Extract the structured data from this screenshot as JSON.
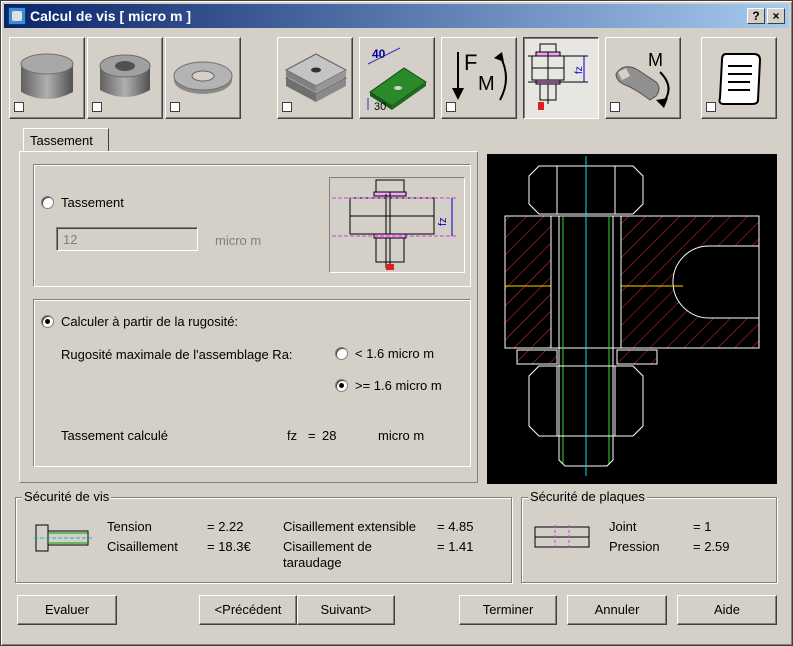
{
  "window": {
    "title": "Calcul de vis [ micro m ]",
    "help_button": "?",
    "close_button": "×"
  },
  "toolbar": {
    "buttons": [
      {
        "name": "bolt-head",
        "icon": "bolt-head-icon"
      },
      {
        "name": "nut",
        "icon": "nut-icon"
      },
      {
        "name": "washer",
        "icon": "washer-icon"
      },
      {
        "name": "plates",
        "icon": "plates-icon"
      },
      {
        "name": "plate-dimensions",
        "icon": "plate-dimension-icon",
        "label_top": "40",
        "label_bottom": "30"
      },
      {
        "name": "force-moment",
        "icon": "force-moment-icon",
        "label_f": "F",
        "label_m": "M"
      },
      {
        "name": "settlement",
        "icon": "settlement-icon",
        "label": "fz",
        "pressed": true
      },
      {
        "name": "tightening-torque",
        "icon": "wrench-torque-icon",
        "label": "M"
      },
      {
        "name": "report",
        "icon": "report-icon"
      }
    ]
  },
  "tabs": [
    {
      "label": "Tassement"
    }
  ],
  "settlement": {
    "radio_manual_label": "Tassement",
    "manual_value": "12",
    "manual_unit": "micro m",
    "diagram_label": "fz",
    "radio_rough_label": "Calculer à partir de la rugosité:",
    "roughness_label": "Rugosité maximale de l'assemblage Ra:",
    "option_low": "< 1.6  micro m",
    "option_high": ">= 1.6  micro m",
    "computed_label": "Tassement calculé",
    "computed_symbol": "fz",
    "computed_eq": "=",
    "computed_value": "28",
    "computed_unit": "micro m"
  },
  "bolt_safety": {
    "title": "Sécurité de vis",
    "tension_label": "Tension",
    "tension_value": "= 2.22",
    "shear_label": "Cisaillement",
    "shear_value": "= 18.3€",
    "ext_shear_label": "Cisaillement extensible",
    "ext_shear_value": "= 4.85",
    "thread_shear_label_1": "Cisaillement de",
    "thread_shear_label_2": "taraudage",
    "thread_shear_value": "= 1.41"
  },
  "plate_safety": {
    "title": "Sécurité de plaques",
    "joint_label": "Joint",
    "joint_value": "= 1",
    "pressure_label": "Pression",
    "pressure_value": "= 2.59"
  },
  "buttons": {
    "evaluate": "Evaluer",
    "previous": "<Précédent",
    "next": "Suivant>",
    "finish": "Terminer",
    "cancel": "Annuler",
    "help": "Aide"
  },
  "colors": {
    "titlebar_start": "#0a246a",
    "titlebar_end": "#a6caf0",
    "dialog_face": "#d4d0c8",
    "preview_bg": "#000000",
    "hatch": "#e03030",
    "axis": "#00e0e0"
  }
}
